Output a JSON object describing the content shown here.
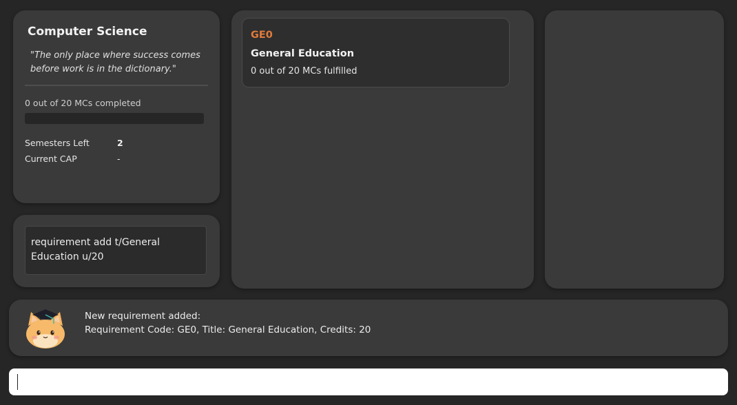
{
  "profile": {
    "degree_title": "Computer Science",
    "quote": "\"The only place where success comes before work is in the dictionary.\"",
    "mc_progress_text": "0 out of 20 MCs completed",
    "mc_progress_fraction": 0,
    "semesters_left_label": "Semesters Left",
    "semesters_left_value": "2",
    "current_cap_label": "Current CAP",
    "current_cap_value": "-"
  },
  "history": {
    "last_command": "requirement add t/General Education u/20"
  },
  "requirements": [
    {
      "code": "GE0",
      "title": "General Education",
      "progress": "0 out of 20 MCs fulfilled"
    }
  ],
  "result": {
    "mascot_icon": "graduate-cat-icon",
    "line1": "New requirement added:",
    "line2": "Requirement Code: GE0, Title: General Education, Credits: 20"
  },
  "command_input": {
    "value": ""
  },
  "colors": {
    "background": "#262626",
    "panel": "#3a3a3a",
    "accent": "#e07b3c"
  }
}
